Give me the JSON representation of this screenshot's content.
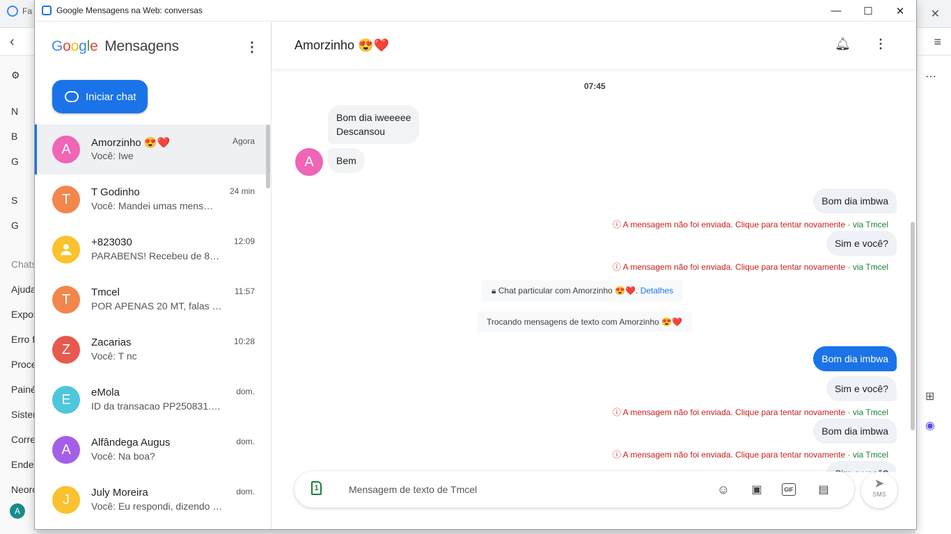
{
  "background": {
    "tab_title": "Fa",
    "sidebar_items": [
      "N",
      "B",
      "G",
      "S",
      "G",
      "Chats",
      "Ajuda",
      "Expor",
      "Erro f",
      "Proce",
      "Painé",
      "Sisten",
      "Corre",
      "Ender",
      "Neoro"
    ],
    "user_initial": "A"
  },
  "window": {
    "title": "Google Mensagens na Web: conversas"
  },
  "app": {
    "logo_letters": [
      "G",
      "o",
      "o",
      "g",
      "l",
      "e"
    ],
    "logo_product": "Mensagens",
    "new_chat_label": "Iniciar chat"
  },
  "conversations": [
    {
      "initial": "A",
      "name": "Amorzinho 😍❤️",
      "preview": "Você: Iwe",
      "time": "Agora",
      "color": "#f065b5"
    },
    {
      "initial": "T",
      "name": "T Godinho",
      "preview": "Você: Mandei umas mens…",
      "time": "24 min",
      "color": "#f2874d"
    },
    {
      "initial": "",
      "name": "+823030",
      "preview": "PARABENS! Recebeu de 82…",
      "time": "12:09",
      "color": "#f9c22e"
    },
    {
      "initial": "T",
      "name": "Tmcel",
      "preview": "POR APENAS 20 MT, falas …",
      "time": "11:57",
      "color": "#f2874d"
    },
    {
      "initial": "Z",
      "name": "Zacarias",
      "preview": "Você: T nc",
      "time": "10:28",
      "color": "#e6594e"
    },
    {
      "initial": "E",
      "name": "eMola",
      "preview": "ID da transacao PP250831.…",
      "time": "dom.",
      "color": "#4ec6dc"
    },
    {
      "initial": "A",
      "name": "Alfândega Augus",
      "preview": "Você: Na boa?",
      "time": "dom.",
      "color": "#a55ee8"
    },
    {
      "initial": "J",
      "name": "July Moreira",
      "preview": "Você: Eu respondi, dizendo …",
      "time": "dom.",
      "color": "#f9c22e"
    }
  ],
  "chat": {
    "title": "Amorzinho 😍❤️",
    "timestamp": "07:45",
    "incoming": {
      "line1": "Bom dia iweeeee",
      "line2": "Descansou",
      "line3": "Bem",
      "avatar_initial": "A"
    },
    "outgoing": [
      {
        "text": "Bom dia imbwa"
      },
      {
        "text": "Sim e você?"
      },
      {
        "text": "Bom dia imbwa"
      },
      {
        "text": "Sim e você?"
      },
      {
        "text": "Bom dia imbwa"
      },
      {
        "text": "Sim e você?"
      }
    ],
    "error_text": "A mensagem não foi enviada. Clique para tentar novamente",
    "via_text": "· via Tmcel",
    "private_chat": "Chat particular com Amorzinho 😍❤️.",
    "private_details": "Detalhes",
    "texting_notice": "Trocando mensagens de texto com Amorzinho 😍❤️"
  },
  "composer": {
    "placeholder": "Mensagem de texto de Tmcel",
    "sim_label": "1",
    "gif_label": "GIF",
    "send_label": "SMS"
  },
  "colors": {
    "accent": "#1a73e8",
    "error": "#c5221f",
    "via": "#188038"
  }
}
